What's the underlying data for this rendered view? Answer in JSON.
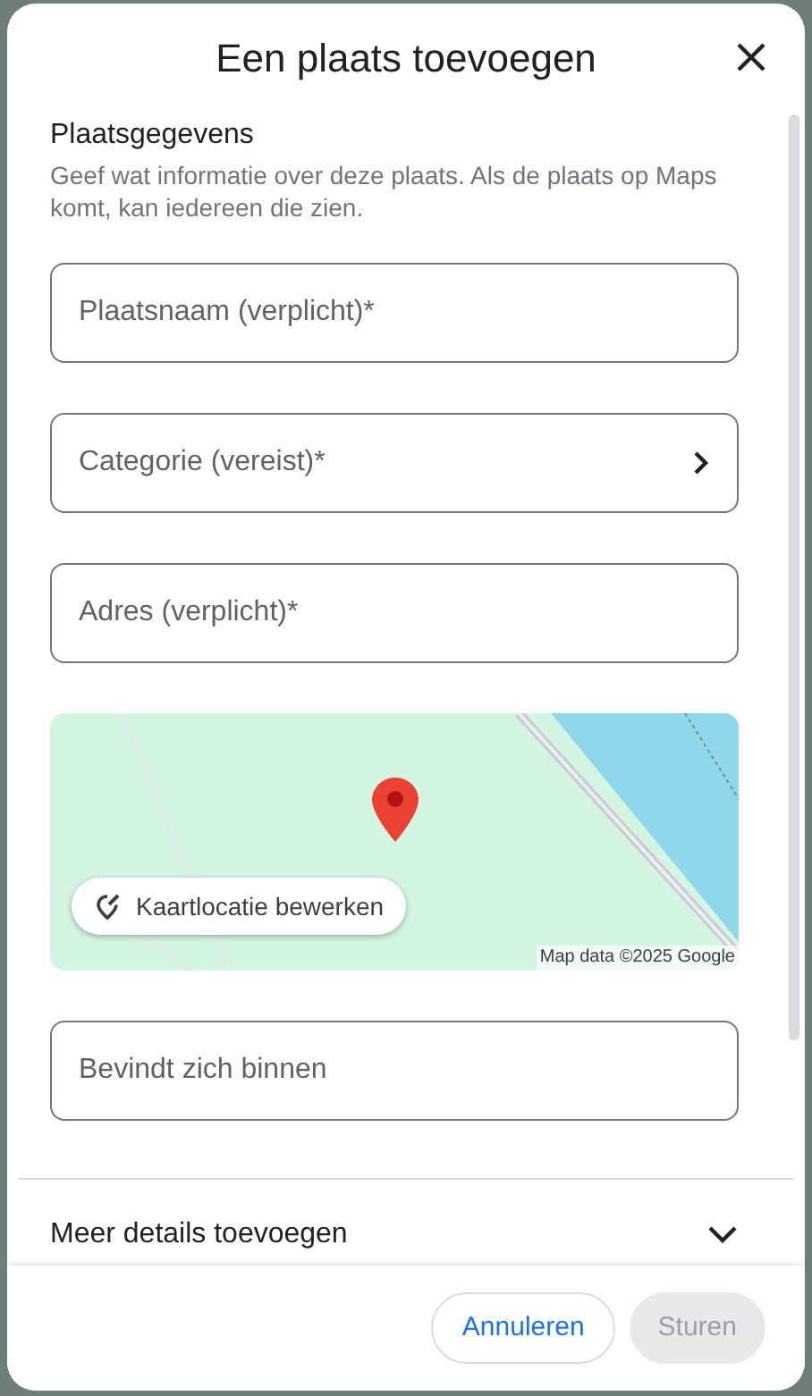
{
  "dialog": {
    "title": "Een plaats toevoegen"
  },
  "section": {
    "heading": "Plaatsgegevens",
    "description": "Geef wat informatie over deze plaats. Als de plaats op Maps komt, kan iedereen die zien."
  },
  "fields": [
    {
      "kind": "text",
      "placeholder": "Plaatsnaam (verplicht)*"
    },
    {
      "kind": "select",
      "placeholder": "Categorie (vereist)*"
    },
    {
      "kind": "text",
      "placeholder": "Adres (verplicht)*"
    },
    {
      "kind": "map",
      "button": "Kaartlocatie bewerken",
      "attribution": "Map data ©2025 Google"
    },
    {
      "kind": "text",
      "placeholder": "Bevindt zich binnen"
    }
  ],
  "more_details": {
    "heading": "Meer details toevoegen",
    "expanded": false
  },
  "buttons": [
    {
      "label": "Annuleren",
      "disabled": false
    },
    {
      "label": "Sturen",
      "disabled": true
    }
  ]
}
